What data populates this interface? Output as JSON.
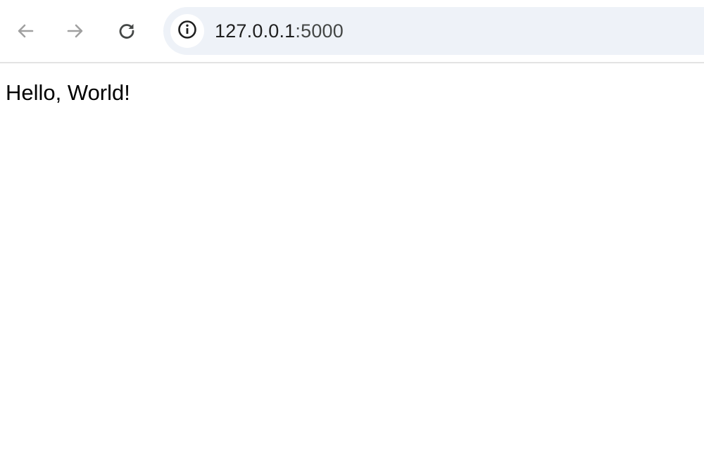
{
  "browser": {
    "address_bar": {
      "host": "127.0.0.1",
      "port": ":5000"
    },
    "icons": {
      "back": "arrow-left-icon",
      "forward": "arrow-right-icon",
      "reload": "reload-icon",
      "site_info": "info-icon"
    },
    "colors": {
      "omnibox_bg": "#eef2f8",
      "disabled_icon": "#a0a0a0",
      "active_icon": "#444746"
    }
  },
  "page": {
    "body_text": "Hello, World!"
  }
}
